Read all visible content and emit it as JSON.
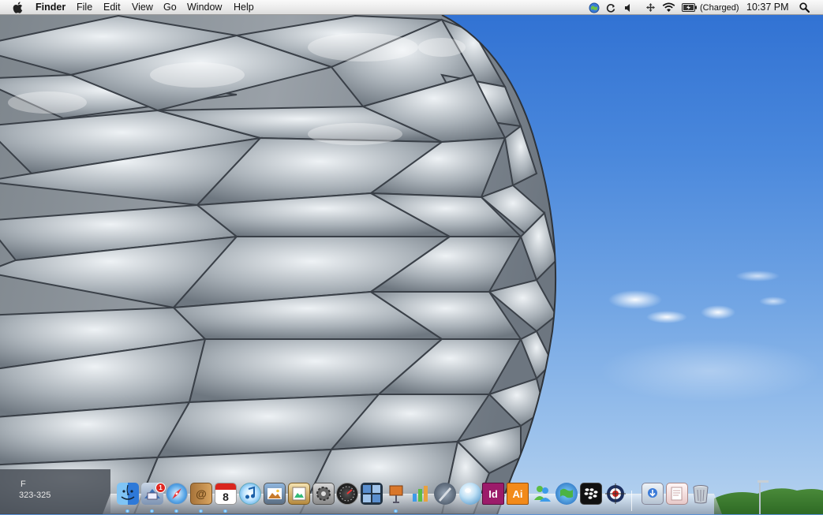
{
  "menubar": {
    "apple_icon": "apple-icon",
    "app_name": "Finder",
    "menus": [
      "File",
      "Edit",
      "View",
      "Go",
      "Window",
      "Help"
    ],
    "battery_status": "(Charged)",
    "clock": "10:37 PM"
  },
  "wallpaper": {
    "stadium_sign": "323-325",
    "stadium_sign_prefix": "F"
  },
  "dock": {
    "mail_badge": "1",
    "calendar_day": "8",
    "indesign_label": "Id",
    "illustrator_label": "Ai",
    "apps": [
      "finder-icon",
      "mail-icon",
      "safari-icon",
      "address-book-icon",
      "ical-icon",
      "itunes-icon",
      "iphoto-icon",
      "preview-icon",
      "system-preferences-icon",
      "dashboard-icon",
      "spaces-icon",
      "keynote-icon",
      "numbers-icon",
      "pen-tool-icon",
      "marble-icon",
      "indesign-icon",
      "illustrator-icon",
      "messenger-icon",
      "globe-icon",
      "blackberry-icon",
      "target-icon",
      "downloads-icon",
      "documents-icon",
      "trash-icon"
    ]
  },
  "colors": {
    "sky_top": "#2f70d2",
    "sky_bottom": "#b7d3ef",
    "menubar": "#ececec",
    "indesign": "#9c1b6a",
    "illustrator": "#f28a1a"
  }
}
